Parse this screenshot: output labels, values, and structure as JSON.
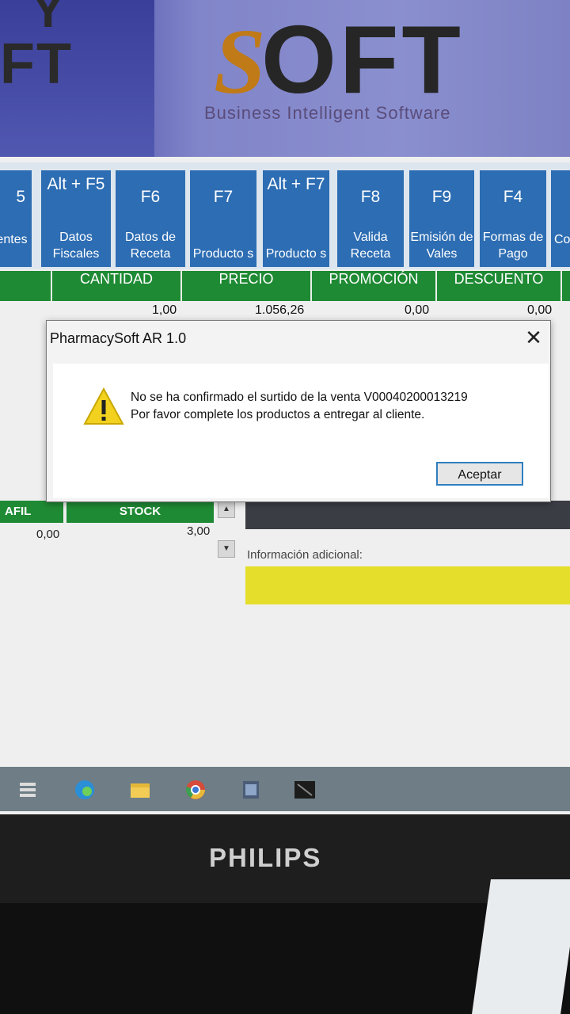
{
  "banner": {
    "logo_left_top": "Y",
    "logo_left": "FT",
    "logo_s": "S",
    "logo_main": "OFT",
    "tagline": "Business Intelligent Software"
  },
  "toolbar": {
    "keys": [
      {
        "key": "5",
        "label": "entes"
      },
      {
        "key": "Alt + F5",
        "label": "Datos Fiscales"
      },
      {
        "key": "F6",
        "label": "Datos de Receta"
      },
      {
        "key": "F7",
        "label": "Producto s"
      },
      {
        "key": "Alt + F7",
        "label": "Producto s"
      },
      {
        "key": "F8",
        "label": "Valida Receta"
      },
      {
        "key": "F9",
        "label": "Emisión de Vales"
      },
      {
        "key": "F4",
        "label": "Formas de Pago"
      },
      {
        "key": "",
        "label": "Co"
      }
    ]
  },
  "grid": {
    "headers": [
      "CANTIDAD",
      "PRECIO",
      "PROMOCIÓN",
      "DESCUENTO"
    ],
    "row": {
      "cantidad": "1,00",
      "precio": "1.056,26",
      "promocion": "0,00",
      "descuento": "0,00"
    }
  },
  "lower": {
    "afil_header": "AFIL",
    "stock_header": "STOCK",
    "afil_value": "0,00",
    "stock_value": "3,00",
    "info_label": "Información adicional:",
    "info_value": ""
  },
  "dialog": {
    "title": "PharmacySoft AR 1.0",
    "close": "✕",
    "message_line1": "No se ha confirmado el surtido de la venta V00040200013219",
    "message_line2": "Por favor complete los productos a entregar al cliente.",
    "ok_label": "Aceptar",
    "icon": "warning-icon"
  },
  "taskbar": {
    "icons": [
      "task-view-icon",
      "edge-icon",
      "file-explorer-icon",
      "chrome-icon",
      "app-icon",
      "terminal-icon"
    ]
  },
  "monitor": {
    "brand": "PHILIPS"
  },
  "colors": {
    "toolbar_button": "#2d6db3",
    "grid_header": "#1f8a34",
    "info_field": "#e5de2a",
    "dialog_button_border": "#2f7fc0"
  }
}
